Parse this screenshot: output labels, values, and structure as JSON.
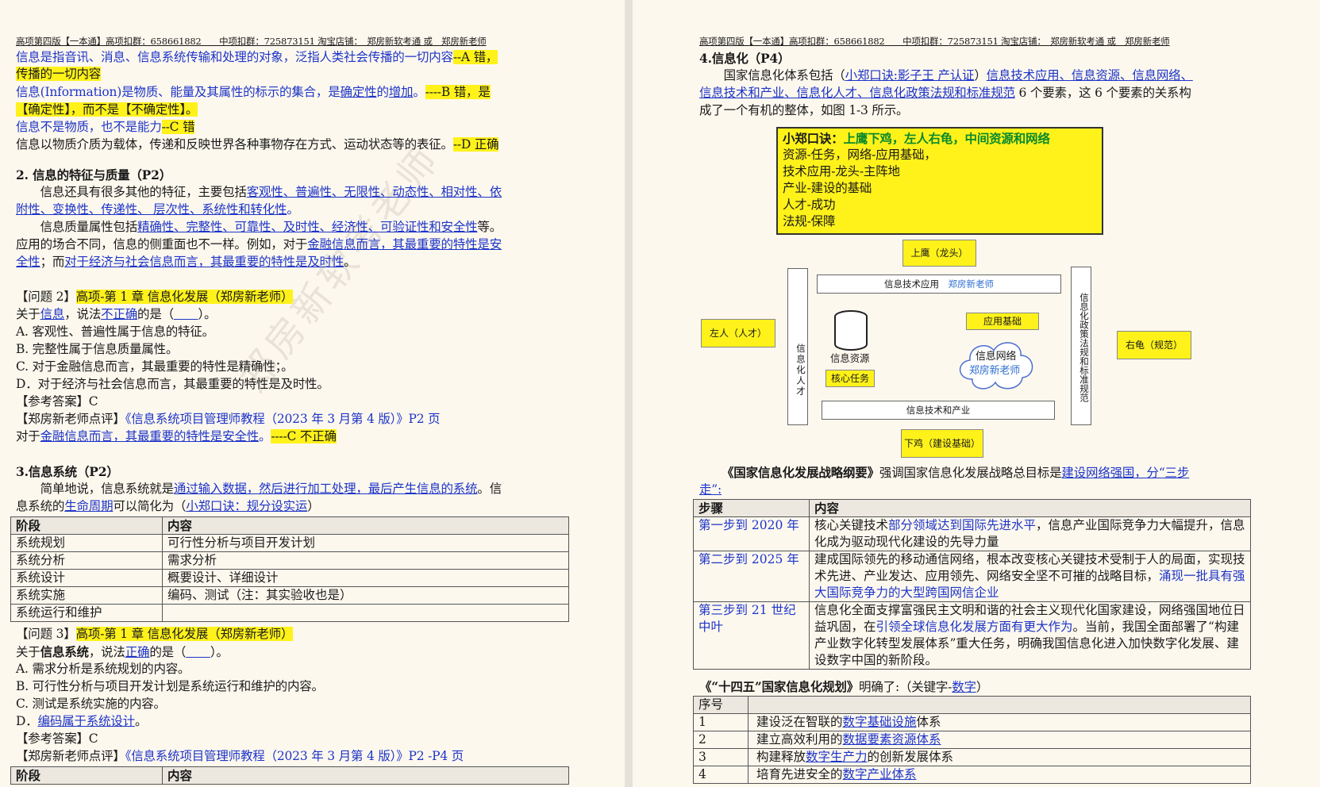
{
  "header": "高项第四版【一本通】高项扣群：658661882　　中项扣群：725873151  淘宝店铺：　郑房新软考通  或　郑房新老师",
  "left": {
    "watermark": "郑房新软考老师",
    "l1a": "信息是指音讯、消息、信息系统传输和处理的对象，泛指人类社会传播的一切内容",
    "l1b": "--A 错，",
    "l2": "传播的一切内容",
    "l3a": "信息(Information)是物质、能量及其属性的标示的集合，是",
    "l3b": "确定性",
    "l3c": "的",
    "l3d": "增加",
    "l3e": "。",
    "l3f": "----B 错，是",
    "l4": "【确定性】，而不是【不确定性】。",
    "l5a": "信息不是物质，也不是能力",
    "l5b": "--C 错",
    "l6a": "信息以物质介质为载体，传递和反映世界各种事物存在方式、运动状态等的表征。",
    "l6b": "--D 正确",
    "h2": "2. 信息的特征与质量（P2）",
    "p1a": "　　信息还具有很多其他的特征，主要包括",
    "p1b": "客观性、普遍性、无限性、动态性、相对性、依",
    "p1c": "附性、变换性、传递性、 层次性、系统性和转化性",
    "p1d": "。",
    "p2a": "　　信息质量属性包括",
    "p2b": "精确性、完整性、可靠性、及时性、经济性、可验证性和安全性",
    "p2c": "等。",
    "p3a": "应用的场合不同，信息的侧重面也不一样。例如，对于",
    "p3b": "金融信息而言，其最重要的特性是安",
    "p4a": "全性",
    "p4b": "；而",
    "p4c": "对于经济与社会信息而言，其最重要的特性是及时性",
    "p4d": "。",
    "q2a": "【问题 2】",
    "q2b": "高项-第 1 章 信息化发展（郑房新老师）",
    "q2c1": "关于",
    "q2c2": "信息",
    "q2c3": "，说法",
    "q2c4": "不正确",
    "q2c5": "的是（",
    "q2c6": "　　",
    "q2c7": "）。",
    "q2A": "A.  客观性、普遍性属于信息的特征。",
    "q2B": "B.  完整性属于信息质量属性。",
    "q2C": "C.  对于金融信息而言，其最重要的特性是精确性；。",
    "q2D": "D．对于经济与社会信息而言，其最重要的特性是及时性。",
    "q2ans": "【参考答案】C",
    "q2ra": "【郑房新老师点评】",
    "q2rb": "《信息系统项目管理师教程（2023 年 3 月第 4 版）》P2 页",
    "q2x1": "对于",
    "q2x2": "金融信息而言，其最重要的特性是",
    "q2x3": "安全性",
    "q2x4": "。",
    "q2x5": "----C 不正确",
    "h3": "3.信息系统（P2）",
    "s1a": "　　简单地说，信息系统就是",
    "s1b": "通过输入数据，然后进行加工处理，最后产生信息的系统",
    "s1c": "。信",
    "s2a": "息系统的",
    "s2b": "生命周期",
    "s2c": "可以简化为（",
    "s2d": "小郑口诀：规分设实运",
    "s2e": "）",
    "t1h1": "阶段",
    "t1h2": "内容",
    "t1": [
      [
        "系统规划",
        "可行性分析与项目开发计划"
      ],
      [
        "系统分析",
        "需求分析"
      ],
      [
        "系统设计",
        "概要设计、详细设计"
      ],
      [
        "系统实施",
        "编码、测试（注：其实验收也是）"
      ],
      [
        "系统运行和维护",
        ""
      ]
    ],
    "q3a": "【问题 3】",
    "q3b": "高项-第 1 章 信息化发展（郑房新老师）",
    "q3c1": "关于",
    "q3c2": "信息系统",
    "q3c3": "，说法",
    "q3c4": "正确",
    "q3c5": "的是（",
    "q3c6": "　　",
    "q3c7": "）。",
    "q3A": "A.  需求分析是系统规划的内容。",
    "q3B": "B.  可行性分析与项目开发计划是系统运行和维护的内容。",
    "q3C": "C.  测试是系统实施的内容。",
    "q3Da": "D．",
    "q3Db": "编码属于系统设计",
    "q3Dc": "。",
    "q3ans": "【参考答案】C",
    "q3ra": "【郑房新老师点评】",
    "q3rb": "《信息系统项目管理师教程（2023 年 3 月第 4 版）》P2 -P4 页",
    "t2h1": "阶段",
    "t2h2": "内容"
  },
  "right": {
    "h4": "4.信息化（P4）",
    "r1a": "　　国家信息化体系包括（",
    "r1b": "小郑口诀:影子王 产认证",
    "r1c": "）",
    "r1d": "信息技术应用、信息资源、信息网络、",
    "r2a": "信息技术和产业、信息化人才、信息化政策法规和标准规范",
    "r2b": " 6 个要素，这 6 个要素的关系构",
    "r3": "成了一个有机的整体，如图 1-3 所示。",
    "mnem_title": "小郑口诀：",
    "mnem_title2": "上鹰下鸡，左人右龟，中间资源和网络",
    "mnem": [
      "资源-任务，网络-应用基础，",
      "技术应用-龙头-主阵地",
      "产业-建设的基础",
      "人才-成功",
      "法规-保障"
    ],
    "d_top": "上鹰（龙头）",
    "d_left": "左人（人才）",
    "d_right": "右龟（规范）",
    "d_bottom": "下鸡（建设基础）",
    "d_app": "信息技术应用",
    "d_app_teacher": "郑房新老师",
    "d_talent": "信息化人才",
    "d_policy": "信息化政策法规和标准规范",
    "d_resource": "信息资源",
    "d_core": "核心任务",
    "d_appbase": "应用基础",
    "d_network": "信息网络",
    "d_network_teacher": "郑房新老师",
    "d_industry": "信息技术和产业",
    "o1a": "《国家信息化发展战略纲要》",
    "o1b": "强调国家信息化发展战略总目标是",
    "o1c": "建设网络强国，分“三步",
    "o2": "走”:",
    "t3h1": "步骤",
    "t3h2": "内容",
    "t3": [
      {
        "step": "第一步到 2020 年",
        "parts": [
          [
            "",
            "核心关键技术"
          ],
          [
            "bl",
            "部分领域达到国际先进水平"
          ],
          [
            "",
            "，信息产业国际竞争力大幅提升，信息化成为驱动现代化建设的先导力量"
          ]
        ]
      },
      {
        "step": "第二步到 2025 年",
        "parts": [
          [
            "",
            "建成国际领先的移动通信网络，根本改变核心关键技术受制于人的局面，实现技术先进、产业发达、应用领先、网络安全坚不可摧的战略目标，"
          ],
          [
            "bl",
            "涌现一批具有强大国际竞争力的大型跨国网信企业"
          ]
        ]
      },
      {
        "step": "第三步到 21 世纪中叶",
        "parts": [
          [
            "",
            "信息化全面支撑富强民主文明和谐的社会主义现代化国家建设，网络强国地位日益巩固，在"
          ],
          [
            "bl",
            "引领全球信息化发展方面有更大作为"
          ],
          [
            "",
            "。当前，我国全面部署了“构建产业数字化转型发展体系”重大任务，明确我国信息化进入加快数字化发展、建设数字中国的新阶段。"
          ]
        ]
      }
    ],
    "p14a": "《“十四五”国家信息化规划》",
    "p14b": "明确了:（关键字-",
    "p14c": "数字",
    "p14d": "）",
    "t4h1": "序号",
    "t4": [
      {
        "n": "1",
        "a": "建设泛在智联的",
        "b": "数字基础设施",
        "c": "体系"
      },
      {
        "n": "2",
        "a": "建立高效利用的",
        "b": "数据要素资源体系",
        "c": ""
      },
      {
        "n": "3",
        "a": "构建释放",
        "b": "数字生产力",
        "c": "的创新发展体系"
      },
      {
        "n": "4",
        "a": "培育先进安全的",
        "b": "数字产业体系",
        "c": ""
      }
    ]
  }
}
